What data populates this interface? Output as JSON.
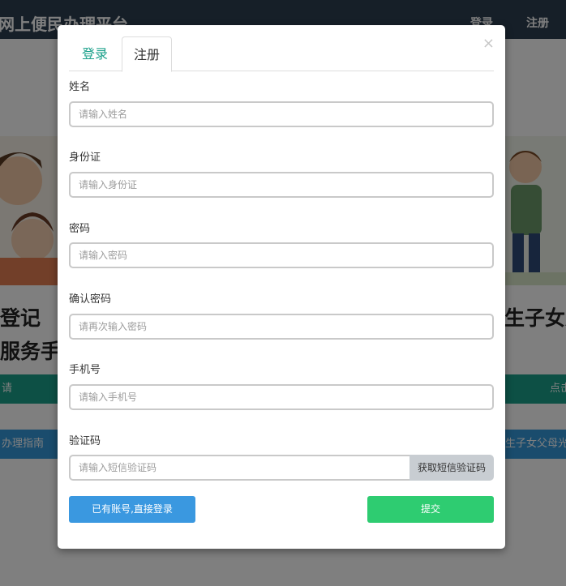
{
  "background": {
    "site_title": "网上便民办理平台",
    "nav_login": "登录",
    "nav_register": "注册",
    "left_heading_1": "登记",
    "left_heading_2": "服务手册",
    "right_heading": "生子女父",
    "left_teal_bar": "请",
    "right_teal_bar": "点击",
    "left_blue_bar": "办理指南",
    "right_blue_bar": "生子女父母光"
  },
  "modal": {
    "close_glyph": "×",
    "tabs": [
      {
        "label": "登录"
      },
      {
        "label": "注册"
      }
    ],
    "fields": {
      "name": {
        "label": "姓名",
        "placeholder": "请输入姓名"
      },
      "id_card": {
        "label": "身份证",
        "placeholder": "请输入身份证"
      },
      "password": {
        "label": "密码",
        "placeholder": "请输入密码"
      },
      "confirm_password": {
        "label": "确认密码",
        "placeholder": "请再次输入密码"
      },
      "phone": {
        "label": "手机号",
        "placeholder": "请输入手机号"
      },
      "sms_code": {
        "label": "验证码",
        "placeholder": "请输入短信验证码"
      }
    },
    "get_code_label": "获取短信验证码",
    "have_account_label": "已有账号,直接登录",
    "submit_label": "提交"
  },
  "colors": {
    "accent_teal": "#1aa08a",
    "primary_blue": "#3a98e0",
    "success_green": "#2ecc71",
    "header_dark": "#2d3e50"
  }
}
